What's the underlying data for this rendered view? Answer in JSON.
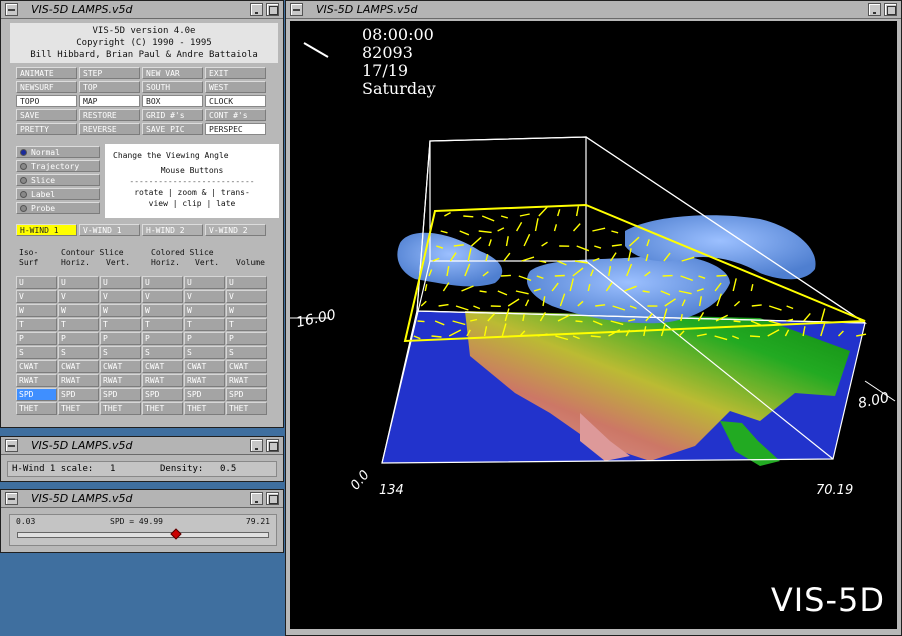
{
  "control_window": {
    "title": "VIS-5D LAMPS.v5d"
  },
  "header": {
    "line1": "VIS-5D version 4.0e",
    "line2": "Copyright (C) 1990 - 1995",
    "line3": "Bill Hibbard, Brian Paul & Andre Battaiola"
  },
  "buttons": [
    {
      "label": "ANIMATE",
      "on": false
    },
    {
      "label": "STEP",
      "on": false
    },
    {
      "label": "NEW VAR",
      "on": false
    },
    {
      "label": "EXIT",
      "on": false
    },
    {
      "label": "NEWSURF",
      "on": false
    },
    {
      "label": "TOP",
      "on": false
    },
    {
      "label": "SOUTH",
      "on": false
    },
    {
      "label": "WEST",
      "on": false
    },
    {
      "label": "TOPO",
      "on": true
    },
    {
      "label": "MAP",
      "on": true
    },
    {
      "label": "BOX",
      "on": true
    },
    {
      "label": "CLOCK",
      "on": true
    },
    {
      "label": "SAVE",
      "on": false
    },
    {
      "label": "RESTORE",
      "on": false
    },
    {
      "label": "GRID #'s",
      "on": false
    },
    {
      "label": "CONT #'s",
      "on": false
    },
    {
      "label": "PRETTY",
      "on": false
    },
    {
      "label": "REVERSE",
      "on": false
    },
    {
      "label": "SAVE PIC",
      "on": false
    },
    {
      "label": "PERSPEC",
      "on": true
    }
  ],
  "modes": [
    {
      "label": "Normal",
      "selected": true
    },
    {
      "label": "Trajectory",
      "selected": false
    },
    {
      "label": "Slice",
      "selected": false
    },
    {
      "label": "Label",
      "selected": false
    },
    {
      "label": "Probe",
      "selected": false
    }
  ],
  "help": {
    "title": "Change the Viewing Angle",
    "sub": "Mouse Buttons",
    "sep": "--------------------------",
    "row1": "rotate | zoom & | trans-",
    "row2": "view  |  clip  |  late"
  },
  "wind_buttons": [
    {
      "label": "H-WIND 1",
      "active": true
    },
    {
      "label": "V-WIND 1",
      "active": false
    },
    {
      "label": "H-WIND 2",
      "active": false
    },
    {
      "label": "V-WIND 2",
      "active": false
    }
  ],
  "columns": {
    "iso": "Iso-",
    "surf": "Surf",
    "contour": "Contour Slice",
    "c_horiz": "Horiz.",
    "c_vert": "Vert.",
    "colored": "Colored Slice",
    "k_horiz": "Horiz.",
    "k_vert": "Vert.",
    "volume": "Volume"
  },
  "variables": [
    "U",
    "V",
    "W",
    "T",
    "P",
    "S",
    "CWAT",
    "RWAT",
    "SPD",
    "THET"
  ],
  "selected_variable": "SPD",
  "hwind_window": {
    "title": "VIS-5D LAMPS.v5d",
    "scale_label": "H-Wind 1 scale:",
    "scale_value": "1",
    "density_label": "Density:",
    "density_value": "0.5"
  },
  "slider_window": {
    "title": "VIS-5D LAMPS.v5d",
    "min": "0.03",
    "label": "SPD = 49.99",
    "max": "79.21",
    "value_fraction": 0.63
  },
  "display_window": {
    "title": "VIS-5D LAMPS.v5d",
    "time": "08:00:00",
    "date": "82093",
    "step": "17/19",
    "day": "Saturday",
    "axis_left_label": "16.00",
    "axis_right_label": "8.00",
    "axis_origin": "0.0",
    "axis_x_left": "134",
    "axis_x_right": "70.19",
    "logo": "VIS-5D"
  },
  "colors": {
    "ocean": "#2233cc",
    "land_low": "#22aa22",
    "land_mid": "#dddd22",
    "land_high": "#dd8888",
    "isosurface": "#6a9ae8",
    "wind_vector": "#ffff00",
    "box": "#ffffff",
    "selected_cell": "#3f8fff"
  }
}
